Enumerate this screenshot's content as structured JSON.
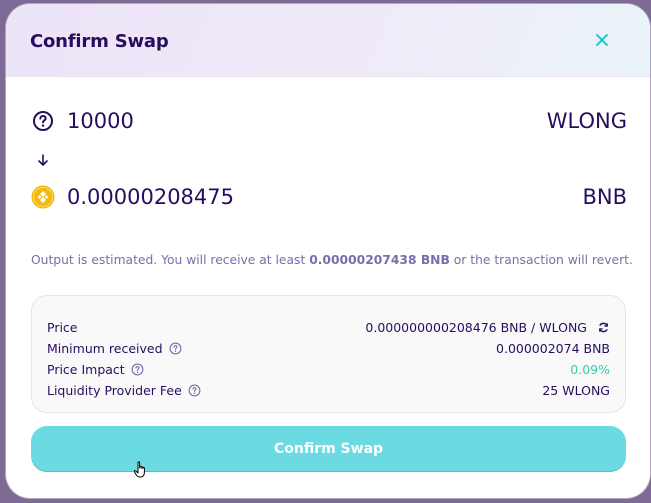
{
  "modal": {
    "title": "Confirm Swap",
    "close_icon": "close-icon"
  },
  "input_token": {
    "icon": "question-circle-icon",
    "amount": "10000",
    "symbol": "WLONG"
  },
  "arrow_icon": "arrow-down-icon",
  "output_token": {
    "icon": "bnb-coin-icon",
    "amount": "0.00000208475",
    "symbol": "BNB"
  },
  "estimate": {
    "prefix": "Output is estimated. You will receive at least ",
    "amount": "0.00000207438 BNB",
    "suffix": " or the transaction will revert."
  },
  "details": {
    "price": {
      "label": "Price",
      "value": "0.000000000208476 BNB / WLONG",
      "icon": "refresh-icon"
    },
    "minimum_received": {
      "label": "Minimum received",
      "value": "0.000002074 BNB",
      "icon": "question-icon"
    },
    "price_impact": {
      "label": "Price Impact",
      "value": "0.09%",
      "icon": "question-icon"
    },
    "lp_fee": {
      "label": "Liquidity Provider Fee",
      "value": "25 WLONG",
      "icon": "question-icon"
    }
  },
  "confirm_button": {
    "label": "Confirm Swap"
  },
  "colors": {
    "primary_text": "#280d5f",
    "secondary_text": "#7a6eaa",
    "accent": "#1fc7d4",
    "success": "#31d0aa",
    "button_disabled": "#6cdae2"
  }
}
